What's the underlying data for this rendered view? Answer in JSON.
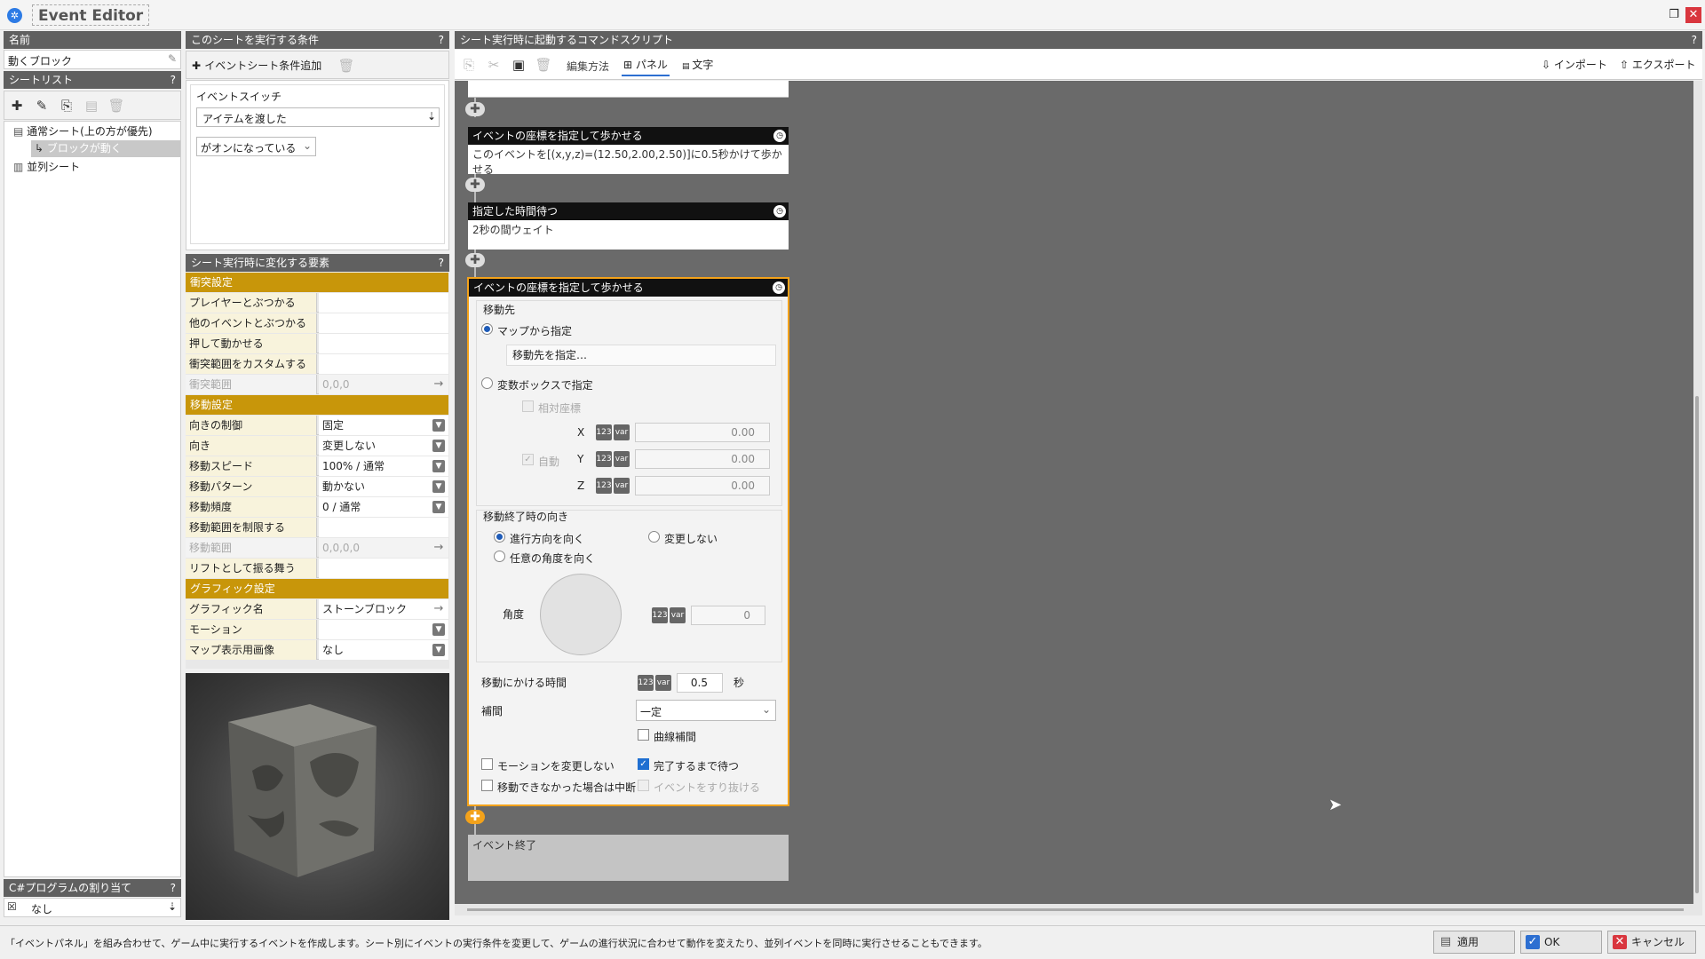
{
  "window": {
    "title": "Event Editor",
    "app_icon": "gear-icon",
    "restore_icon": "restore-icon",
    "close_icon": "close-icon"
  },
  "left": {
    "name_header": "名前",
    "name_value": "動くブロック",
    "sheet_list_header": "シートリスト",
    "help": "?",
    "tree": [
      {
        "label": "通常シート(上の方が優先)"
      },
      {
        "label": "ブロックが動く"
      },
      {
        "label": "並列シート"
      }
    ],
    "csharp_header": "C#プログラムの割り当て",
    "csharp_value": "なし"
  },
  "conditions": {
    "header": "このシートを実行する条件",
    "add_button": "イベントシート条件追加",
    "group_label": "イベントスイッチ",
    "switch_value": "アイテムを渡した",
    "state_value": "がオンになっている"
  },
  "props": {
    "header": "シート実行時に変化する要素",
    "collision_section": "衝突設定",
    "player_collide": "プレイヤーとぶつかる",
    "event_collide": "他のイベントとぶつかる",
    "push_move": "押して動かせる",
    "custom_range": "衝突範囲をカスタムする",
    "collision_range": "衝突範囲",
    "collision_range_value": "0,0,0",
    "move_section": "移動設定",
    "dir_control": "向きの制御",
    "dir_control_value": "固定",
    "direction": "向き",
    "direction_value": "変更しない",
    "speed": "移動スピード",
    "speed_value": "100% / 通常",
    "pattern": "移動パターン",
    "pattern_value": "動かない",
    "frequency": "移動頻度",
    "frequency_value": "0 / 通常",
    "limit_range": "移動範囲を制限する",
    "move_range": "移動範囲",
    "move_range_value": "0,0,0,0",
    "lift": "リフトとして振る舞う",
    "graphic_section": "グラフィック設定",
    "graphic_name": "グラフィック名",
    "graphic_name_value": "ストーンブロック",
    "motion": "モーション",
    "motion_value": "",
    "map_image": "マップ表示用画像",
    "map_image_value": "なし"
  },
  "script": {
    "header": "シート実行時に起動するコマンドスクリプト",
    "edit_method": "編集方法",
    "panel_tab": "パネル",
    "text_tab": "文字",
    "import": "インポート",
    "export": "エクスポート",
    "commands": {
      "c1_title": "イベントの座標を指定して歩かせる",
      "c1_body": "このイベントを[(x,y,z)=(12.50,2.00,2.50)]に0.5秒かけて歩かせる",
      "c2_title": "指定した時間待つ",
      "c2_body": "2秒の間ウェイト",
      "c3_title": "イベントの座標を指定して歩かせる",
      "end_label": "イベント終了"
    },
    "detail": {
      "dest_label": "移動先",
      "from_map": "マップから指定",
      "pick_dest": "移動先を指定…",
      "from_var": "変数ボックスで指定",
      "relative": "相対座標",
      "auto": "自動",
      "x_label": "X",
      "x_value": "0.00",
      "y_label": "Y",
      "y_value": "0.00",
      "z_label": "Z",
      "z_value": "0.00",
      "end_dir_label": "移動終了時の向き",
      "face_travel": "進行方向を向く",
      "no_change": "変更しない",
      "any_angle": "任意の角度を向く",
      "angle_label": "角度",
      "angle_value": "0",
      "time_label": "移動にかける時間",
      "time_value": "0.5",
      "time_unit": "秒",
      "interp_label": "補間",
      "interp_value": "一定",
      "curve_interp": "曲線補間",
      "no_motion_change": "モーションを変更しない",
      "wait_complete": "完了するまで待つ",
      "abort_if_blocked": "移動できなかった場合は中断",
      "pass_through": "イベントをすり抜ける"
    }
  },
  "status": {
    "text": "「イベントパネル」を組み合わせて、ゲーム中に実行するイベントを作成します。シート別にイベントの実行条件を変更して、ゲームの進行状況に合わせて動作を変えたり、並列イベントを同時に実行させることもできます。",
    "apply": "適用",
    "ok": "OK",
    "cancel": "キャンセル"
  },
  "colors": {
    "section": "#c8960a",
    "header": "#606060",
    "command_header": "#111111",
    "selected_border": "#f3a21b",
    "canvas": "#6a6a6a"
  }
}
